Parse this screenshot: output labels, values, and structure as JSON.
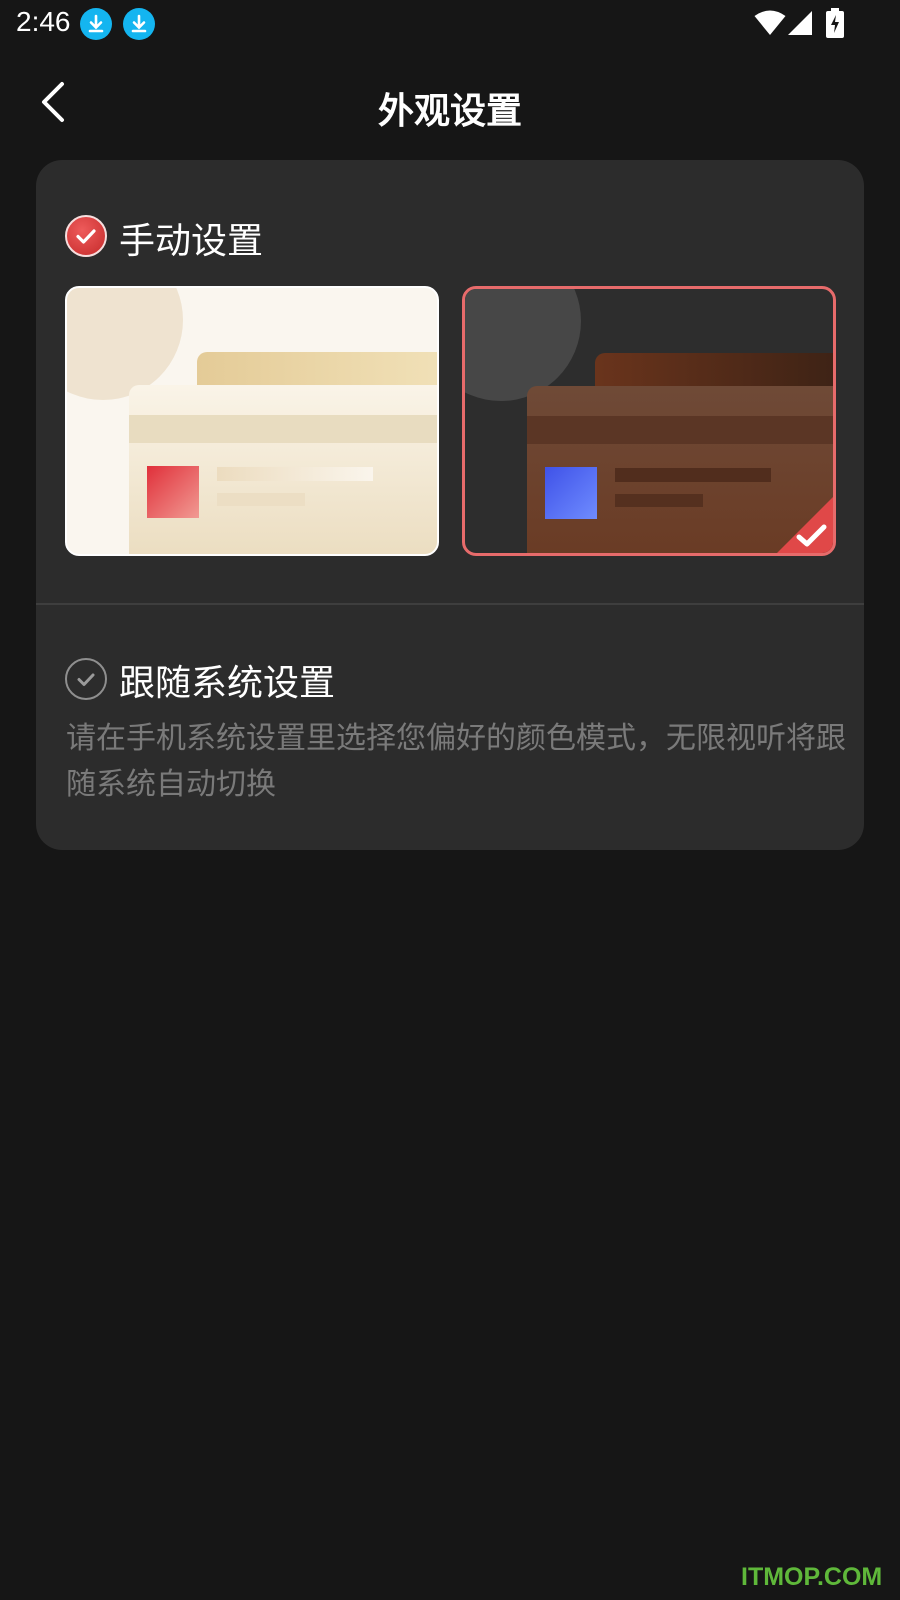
{
  "status_bar": {
    "time": "2:46",
    "icons": [
      "download-icon",
      "download-icon",
      "wifi-icon",
      "signal-icon",
      "battery-charging-icon"
    ]
  },
  "header": {
    "title": "外观设置",
    "back_icon": "chevron-left-icon"
  },
  "appearance": {
    "manual": {
      "label": "手动设置",
      "selected": true,
      "themes": [
        {
          "name": "light",
          "selected": false
        },
        {
          "name": "dark",
          "selected": true
        }
      ]
    },
    "follow_system": {
      "label": "跟随系统设置",
      "selected": false,
      "description": "请在手机系统设置里选择您偏好的颜色模式，无限视听将跟随系统自动切换"
    }
  },
  "colors": {
    "accent": "#e04848",
    "background": "#161616",
    "card": "#2c2c2c"
  },
  "watermark": "ITMOP.COM"
}
